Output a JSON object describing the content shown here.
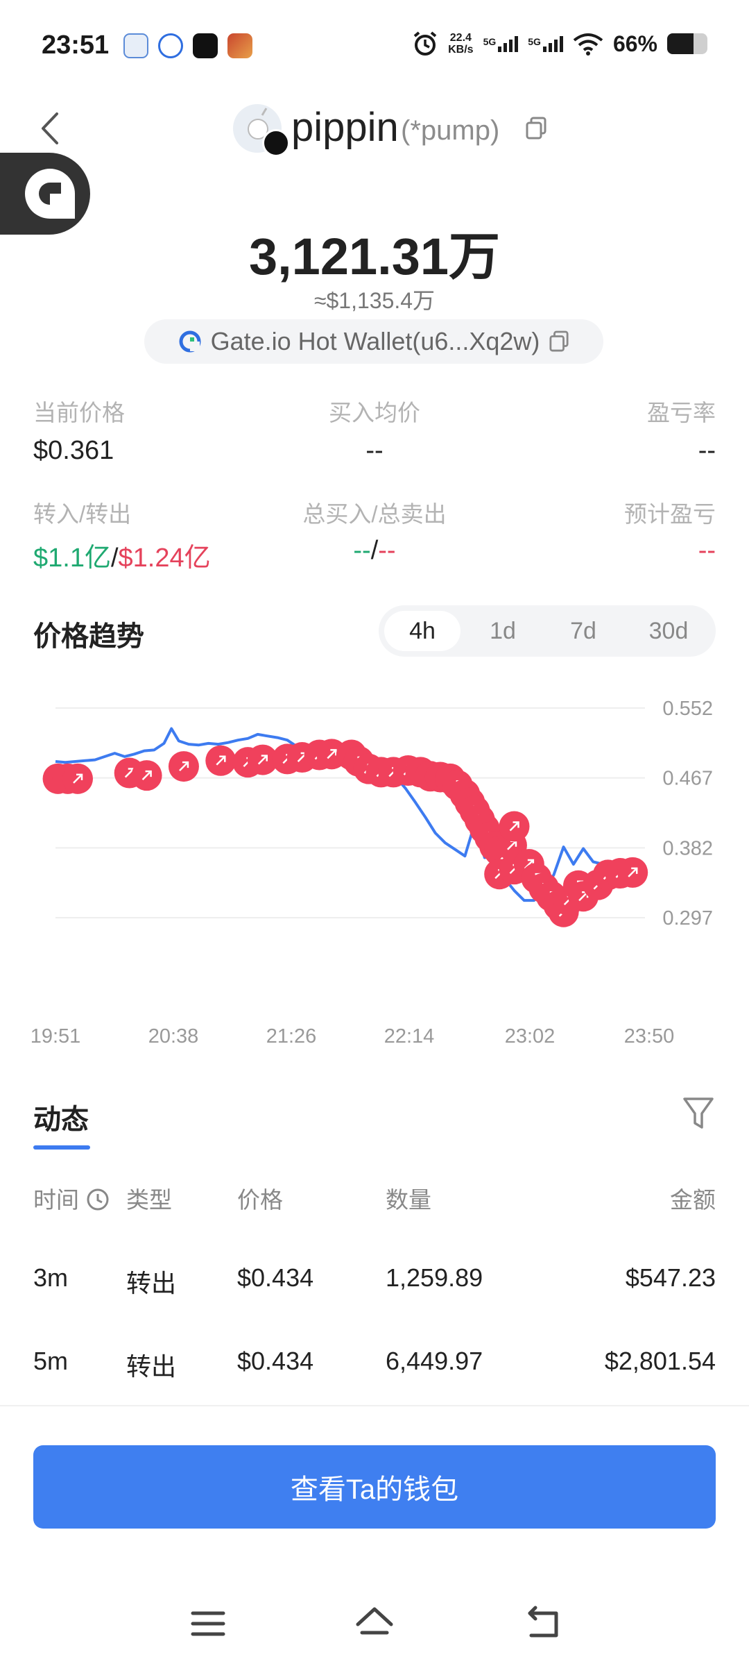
{
  "status_bar": {
    "time": "23:51",
    "net_speed_value": "22.4",
    "net_speed_unit": "KB/s",
    "sim1": "5G",
    "sim2": "5G",
    "battery": "66%",
    "battery_level": 0.66,
    "app_icons": [
      "app-icon-1",
      "app-icon-2",
      "tiktok-icon",
      "game-icon"
    ]
  },
  "header": {
    "token_name": "pippin",
    "token_tag": "(*pump)"
  },
  "balance": {
    "amount": "3,121.31万",
    "usd": "≈$1,135.4万",
    "wallet": "Gate.io Hot Wallet(u6...Xq2w)"
  },
  "stats": [
    {
      "label": "当前价格",
      "value": "$0.361"
    },
    {
      "label": "买入均价",
      "value": "--"
    },
    {
      "label": "盈亏率",
      "value": "--"
    },
    {
      "label": "转入/转出",
      "value_in": "$1.1亿",
      "sep": "/",
      "value_out": "$1.24亿"
    },
    {
      "label": "总买入/总卖出",
      "value_in": "--",
      "sep": "/",
      "value_out": "--"
    },
    {
      "label": "预计盈亏",
      "value": "--"
    }
  ],
  "price_trend": {
    "title": "价格趋势",
    "tabs": [
      "4h",
      "1d",
      "7d",
      "30d"
    ],
    "active_tab": "4h"
  },
  "chart_data": {
    "type": "line",
    "y_ticks": [
      "0.552",
      "0.467",
      "0.382",
      "0.297"
    ],
    "ylim": [
      0.297,
      0.552
    ],
    "x_ticks": [
      "19:51",
      "20:38",
      "21:26",
      "22:14",
      "23:02",
      "23:50"
    ],
    "grid": true,
    "line_color": "#3d7bf0",
    "marker_color": "#f0415c",
    "series": [
      {
        "x": [
          0,
          4,
          8,
          12,
          16,
          20,
          24,
          28,
          32,
          36,
          40,
          44,
          47,
          50,
          54,
          58,
          62,
          66,
          70,
          74,
          78,
          82,
          86,
          90,
          94,
          98,
          102,
          106,
          110,
          114,
          118,
          122,
          126,
          130,
          134,
          138,
          142,
          146,
          150,
          154,
          158,
          162,
          166,
          170,
          174,
          178,
          182,
          186,
          190,
          194,
          198,
          202,
          206,
          210,
          214,
          218,
          222,
          226,
          230,
          234,
          238,
          239
        ],
        "values": [
          0.487,
          0.486,
          0.487,
          0.488,
          0.489,
          0.493,
          0.497,
          0.493,
          0.496,
          0.5,
          0.501,
          0.509,
          0.527,
          0.512,
          0.508,
          0.507,
          0.509,
          0.508,
          0.51,
          0.513,
          0.515,
          0.52,
          0.518,
          0.516,
          0.513,
          0.505,
          0.493,
          0.494,
          0.5,
          0.498,
          0.492,
          0.487,
          0.485,
          0.483,
          0.476,
          0.468,
          0.454,
          0.437,
          0.419,
          0.4,
          0.388,
          0.38,
          0.372,
          0.412,
          0.37,
          0.373,
          0.345,
          0.33,
          0.318,
          0.318,
          0.331,
          0.349,
          0.383,
          0.362,
          0.381,
          0.365,
          0.362,
          0.364,
          0.363,
          0.362,
          0.361,
          0.361
        ],
        "transfer_markers": [
          {
            "x": 1,
            "value": 0.466
          },
          {
            "x": 5,
            "value": 0.466
          },
          {
            "x": 9,
            "value": 0.466
          },
          {
            "x": 30,
            "value": 0.473
          },
          {
            "x": 37,
            "value": 0.47
          },
          {
            "x": 52,
            "value": 0.481
          },
          {
            "x": 67,
            "value": 0.488
          },
          {
            "x": 78,
            "value": 0.486
          },
          {
            "x": 84,
            "value": 0.489
          },
          {
            "x": 94,
            "value": 0.49
          },
          {
            "x": 100,
            "value": 0.492
          },
          {
            "x": 107,
            "value": 0.495
          },
          {
            "x": 112,
            "value": 0.496
          },
          {
            "x": 120,
            "value": 0.495
          },
          {
            "x": 123,
            "value": 0.487
          },
          {
            "x": 127,
            "value": 0.478
          },
          {
            "x": 132,
            "value": 0.474
          },
          {
            "x": 137,
            "value": 0.474
          },
          {
            "x": 143,
            "value": 0.476
          },
          {
            "x": 148,
            "value": 0.474
          },
          {
            "x": 152,
            "value": 0.469
          },
          {
            "x": 156,
            "value": 0.468
          },
          {
            "x": 160,
            "value": 0.466
          },
          {
            "x": 163,
            "value": 0.458
          },
          {
            "x": 166,
            "value": 0.447
          },
          {
            "x": 168,
            "value": 0.437
          },
          {
            "x": 170,
            "value": 0.427
          },
          {
            "x": 172,
            "value": 0.416
          },
          {
            "x": 174,
            "value": 0.405
          },
          {
            "x": 176,
            "value": 0.395
          },
          {
            "x": 178,
            "value": 0.384
          },
          {
            "x": 180,
            "value": 0.378
          },
          {
            "x": 182,
            "value": 0.372
          },
          {
            "x": 180,
            "value": 0.35
          },
          {
            "x": 186,
            "value": 0.356
          },
          {
            "x": 185,
            "value": 0.385
          },
          {
            "x": 186,
            "value": 0.408
          },
          {
            "x": 192,
            "value": 0.362
          },
          {
            "x": 195,
            "value": 0.345
          },
          {
            "x": 198,
            "value": 0.333
          },
          {
            "x": 201,
            "value": 0.323
          },
          {
            "x": 204,
            "value": 0.312
          },
          {
            "x": 206,
            "value": 0.304
          },
          {
            "x": 208,
            "value": 0.318
          },
          {
            "x": 212,
            "value": 0.336
          },
          {
            "x": 214,
            "value": 0.323
          },
          {
            "x": 220,
            "value": 0.337
          },
          {
            "x": 224,
            "value": 0.349
          },
          {
            "x": 229,
            "value": 0.351
          },
          {
            "x": 234,
            "value": 0.352
          }
        ]
      }
    ]
  },
  "activity": {
    "title": "动态",
    "columns": [
      "时间",
      "类型",
      "价格",
      "数量",
      "金额"
    ],
    "rows": [
      {
        "time": "3m",
        "type": "转出",
        "price": "$0.434",
        "qty": "1,259.89",
        "amount": "$547.23"
      },
      {
        "time": "5m",
        "type": "转出",
        "price": "$0.434",
        "qty": "6,449.97",
        "amount": "$2,801.54"
      }
    ]
  },
  "cta_label": "查看Ta的钱包",
  "nav": [
    "menu-icon",
    "home-icon",
    "back-icon"
  ]
}
